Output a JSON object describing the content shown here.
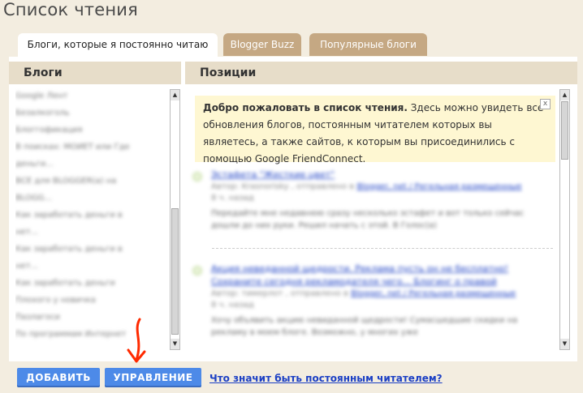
{
  "page": {
    "title": "Список чтения"
  },
  "tabs": [
    {
      "label": "Блоги, которые я постоянно читаю"
    },
    {
      "label": "Blogger Buzz"
    },
    {
      "label": "Популярные блоги"
    }
  ],
  "columns": {
    "blogs": "Блоги",
    "positions": "Позиции"
  },
  "blogs": [
    "Google Лент",
    "Безалкоголь",
    "Блоггофикация",
    "В поисках: МОИЕТ или Где",
    "деньги...",
    "ВСЕ для BLOGGER(а) на",
    "BLOGG...",
    "Как заработать деньги в",
    "нет...",
    "Как заработать деньги в",
    "нет...",
    "Как заработать деньги",
    "Плохого у новичка",
    "Пазлагоси",
    "По программам Интернет"
  ],
  "welcome": {
    "bold": "Добро пожаловать в список чтения.",
    "text": " Здесь можно увидеть все обновления блогов, постоянным читателем которых вы являетесь, а также сайтов, к которым вы присоединились с помощью Google FriendConnect.",
    "close": "x"
  },
  "posts": [
    {
      "title": "Эстафета \"Жесткие цвет\"",
      "meta": "Автор: Krasnorisky , отправлено в",
      "source": "Blogger, net / Регельная размещенные",
      "age": "8 ч. назад",
      "text": "Передайте мне недавнюю сразу несколько эстафет и вот только сейчас дошли до них руки. Решил начать с этой. В Голос(а)"
    },
    {
      "title": "Акция неведанной щедрости. Реклама пусть он не бесплатно! Сохраните сегодня рекламодателя чего... Блогинг о правой",
      "meta": "Автор: тимерлот , отправлено в",
      "source": "Blogger, net / Регельная размещенные",
      "age": "8 ч. назад",
      "text": "Хочу объявить акцию невиданной щедрости! Сумасшедшие скидки на рекламу в моем блоге. Возможно, у многих уже"
    }
  ],
  "buttons": {
    "add": "ДОБАВИТЬ",
    "manage": "УПРАВЛЕНИЕ"
  },
  "help_link": "Что значит быть постоянным читателем?"
}
